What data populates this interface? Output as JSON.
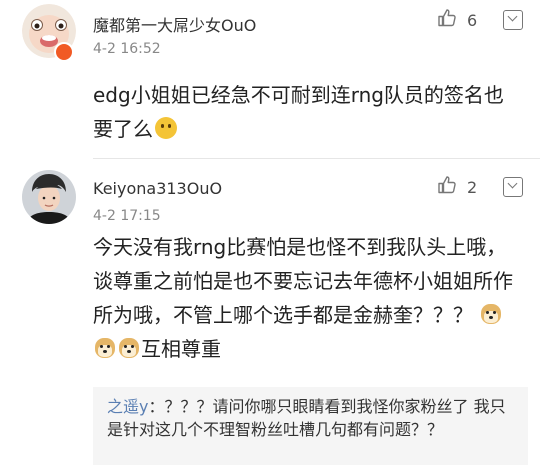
{
  "comments": [
    {
      "username": "魔都第一大屌少女OuO",
      "timestamp": "4-2 16:52",
      "likes": "6",
      "text": "edg小姐姐已经急不可耐到连rng队员的签名也要了么",
      "avatar_icon": "cartoon-avatar",
      "badge_color": "#f15a24"
    },
    {
      "username": "Keiyona313OuO",
      "timestamp": "4-2 17:15",
      "likes": "2",
      "text": "今天没有我rng比赛怕是也怪不到我队头上哦，谈尊重之前怕是也不要忘记去年德杯小姐姐所作所为哦，不管上哪个选手都是金赫奎？？？",
      "text_after_emoji": "互相尊重",
      "avatar_icon": "photo-avatar",
      "reply": {
        "author": "之遥y",
        "text": "：？？？请问你哪只眼睛看到我怪你家粉丝了 我只是针对这几个不理智粉丝吐槽几句都有问题？？"
      }
    }
  ],
  "colors": {
    "accent": "#5a7fb3",
    "meta": "#888888"
  }
}
